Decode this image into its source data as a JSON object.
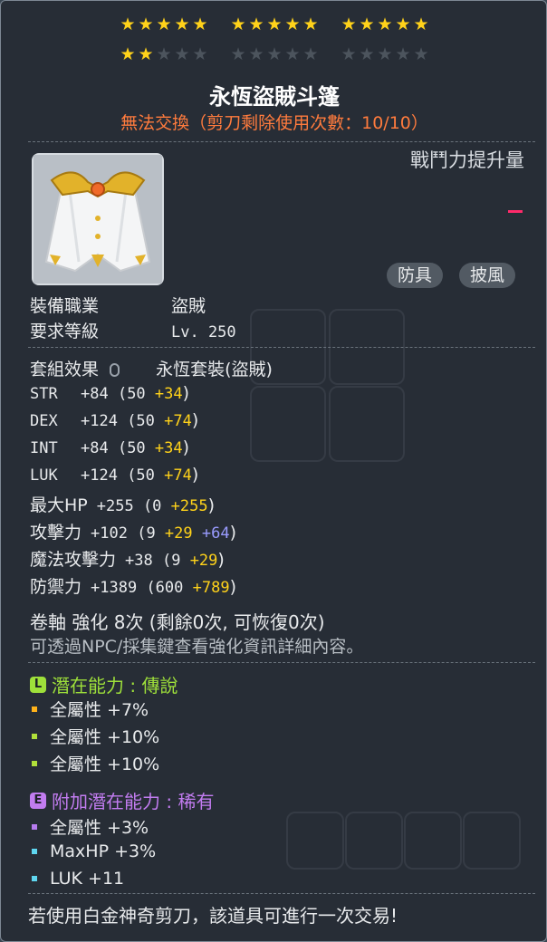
{
  "stars": {
    "row1": [
      5,
      5,
      5
    ],
    "row2_filled": 2,
    "row2_total": 15
  },
  "item": {
    "name": "永恆盜賊斗篷",
    "trade_note": "無法交換（剪刀剩除使用次數：10/10）"
  },
  "combat_power_label": "戰鬥力提升量",
  "tags": [
    "防具",
    "披風"
  ],
  "requirements": {
    "job_label": "裝備職業",
    "job_value": "盜賊",
    "level_label": "要求等級",
    "level_value": "Lv. 250"
  },
  "set_effect": {
    "label": "套組效果",
    "value": "永恆套裝(盜賊)"
  },
  "stats": [
    {
      "name": "STR",
      "total": "+84",
      "base": "(50 ",
      "bonus": "+34",
      "extra": "",
      "close": ")"
    },
    {
      "name": "DEX",
      "total": "+124",
      "base": "(50 ",
      "bonus": "+74",
      "extra": "",
      "close": ")"
    },
    {
      "name": "INT",
      "total": "+84",
      "base": "(50 ",
      "bonus": "+34",
      "extra": "",
      "close": ")"
    },
    {
      "name": "LUK",
      "total": "+124",
      "base": "(50 ",
      "bonus": "+74",
      "extra": "",
      "close": ")"
    },
    {
      "name": "最大HP",
      "total": "+255",
      "base": "(0 ",
      "bonus": "+255",
      "extra": "",
      "close": ")"
    },
    {
      "name": "攻擊力",
      "total": "+102",
      "base": "(9 ",
      "bonus": "+29",
      "extra": " +64",
      "close": ")"
    },
    {
      "name": "魔法攻擊力",
      "total": "+38",
      "base": "(9 ",
      "bonus": "+29",
      "extra": "",
      "close": ")"
    },
    {
      "name": "防禦力",
      "total": "+1389",
      "base": "(600 ",
      "bonus": "+789",
      "extra": "",
      "close": ")"
    }
  ],
  "scroll": {
    "line": "卷軸 強化 8次 (剩餘0次, 可恢復0次)",
    "hint": "可透過NPC/採集鍵查看強化資訊詳細內容。"
  },
  "potential": {
    "title": "潛在能力 : 傳說",
    "badge": "L",
    "color": "#9ee03a",
    "lines": [
      {
        "text": "全屬性 +7%",
        "bullet": "#ffb21a"
      },
      {
        "text": "全屬性 +10%",
        "bullet": "#b0e03a"
      },
      {
        "text": "全屬性 +10%",
        "bullet": "#b0e03a"
      }
    ]
  },
  "additional_potential": {
    "title": "附加潛在能力 : 稀有",
    "badge": "E",
    "color": "#c27cf0",
    "lines": [
      {
        "text": "全屬性 +3%",
        "bullet": "#b77cf0"
      },
      {
        "text": "MaxHP +3%",
        "bullet": "#5fd6f0"
      },
      {
        "text": "LUK +11",
        "bullet": "#5fd6f0"
      }
    ]
  },
  "footer": "若使用白金神奇剪刀，該道具可進行一次交易!"
}
